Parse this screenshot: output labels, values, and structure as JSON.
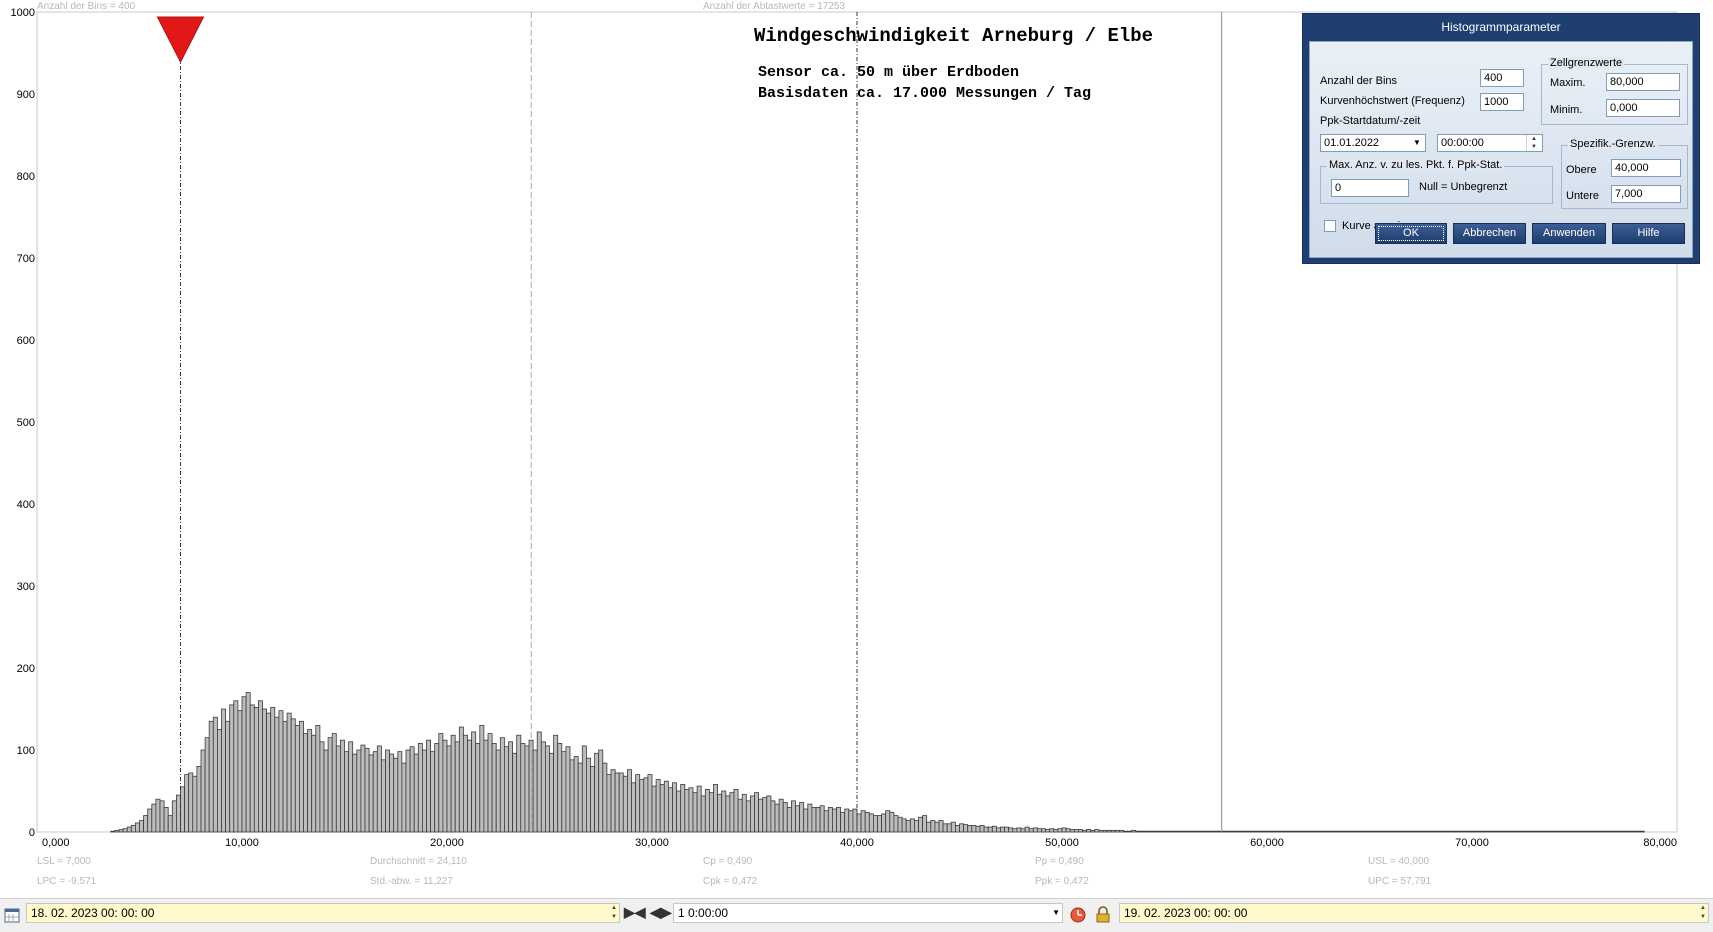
{
  "header_info": {
    "bins_label": "Anzahl der Bins =  400",
    "samples_label": "Anzahl der Abtastwerte = 17253"
  },
  "chart_title": {
    "title": "Windgeschwindigkeit  Arneburg / Elbe",
    "line1": "Sensor ca. 50 m über Erdboden",
    "line2": "Basisdaten ca. 17.000 Messungen / Tag"
  },
  "stats": {
    "lsl": "LSL = 7,000",
    "lpc": "LPC = -9,571",
    "mean": "Durchschnitt  = 24,110",
    "stddev": "Std.-abw. = 11,227",
    "cp": "Cp  = 0,490",
    "cpk": "Cpk = 0,472",
    "pp": "Pp  = 0,490",
    "ppk": "Ppk = 0,472",
    "usl": "USL = 40,000",
    "upc": "UPC = 57,791"
  },
  "chart_data": {
    "type": "bar",
    "title": "Windgeschwindigkeit  Arneburg / Elbe",
    "xlim": [
      0,
      80
    ],
    "ylim": [
      0,
      1000
    ],
    "x_tick_labels": [
      "0,000",
      "10,000",
      "20,000",
      "30,000",
      "40,000",
      "50,000",
      "60,000",
      "70,000",
      "80,000"
    ],
    "y_tick_labels": [
      "1000",
      "900",
      "800",
      "700",
      "600",
      "500",
      "400",
      "300",
      "200",
      "100",
      "0"
    ],
    "grid": false,
    "markers": {
      "lsl": 7.0,
      "mean": 24.11,
      "usl": 40.0,
      "upc": 57.791
    },
    "bin_width": 0.2,
    "series": [
      {
        "x_start": 3.6,
        "values": [
          1,
          2,
          3,
          4,
          6,
          8,
          11,
          14,
          20,
          28,
          34,
          40,
          38,
          30,
          20,
          38,
          45,
          55,
          70,
          72,
          68,
          80,
          100,
          115,
          135,
          140,
          125,
          150,
          135,
          155,
          160,
          148,
          165,
          170,
          155,
          152,
          160,
          150,
          145,
          152,
          140,
          148,
          135,
          145,
          138,
          130,
          135,
          120,
          125,
          118,
          130,
          110,
          100,
          115,
          120,
          105,
          112,
          98,
          110,
          95,
          100,
          106,
          102,
          94,
          98,
          105,
          88,
          100,
          95,
          90,
          98,
          84,
          100,
          104,
          95,
          108,
          100,
          112,
          98,
          108,
          120,
          112,
          105,
          118,
          110,
          128,
          118,
          112,
          122,
          108,
          130,
          112,
          120,
          108,
          100,
          115,
          104,
          110,
          96,
          118,
          108,
          105,
          112,
          100,
          122,
          110,
          105,
          96,
          118,
          108,
          98,
          104,
          88,
          92,
          84,
          105,
          90,
          80,
          96,
          100,
          84,
          70,
          76,
          72,
          72,
          68,
          76,
          60,
          70,
          64,
          66,
          70,
          56,
          64,
          58,
          62,
          54,
          60,
          50,
          58,
          52,
          54,
          48,
          56,
          44,
          52,
          48,
          58,
          46,
          50,
          44,
          48,
          52,
          40,
          46,
          38,
          44,
          48,
          40,
          42,
          44,
          38,
          34,
          40,
          36,
          30,
          38,
          32,
          36,
          28,
          34,
          30,
          30,
          32,
          26,
          30,
          28,
          30,
          24,
          28,
          26,
          28,
          22,
          26,
          24,
          22,
          20,
          20,
          22,
          26,
          24,
          20,
          18,
          16,
          14,
          16,
          14,
          18,
          20,
          12,
          14,
          12,
          14,
          10,
          10,
          12,
          8,
          10,
          9,
          8,
          8,
          7,
          8,
          6,
          6,
          7,
          5,
          6,
          6,
          5,
          4,
          5,
          4,
          6,
          4,
          5,
          4,
          4,
          3,
          4,
          3,
          4,
          5,
          4,
          3,
          3,
          3,
          2,
          3,
          2,
          3,
          2,
          2,
          2,
          2,
          2,
          2,
          1,
          1,
          2,
          1,
          1,
          1,
          1,
          1,
          1,
          1,
          1,
          1,
          1,
          1,
          1,
          1,
          1,
          1,
          1,
          1,
          1,
          1,
          1,
          1,
          1,
          1,
          1,
          1,
          1,
          1,
          1,
          1,
          1,
          1,
          1,
          1,
          1,
          1,
          1,
          1,
          1,
          1,
          1,
          1,
          1,
          1,
          1,
          1,
          1,
          1,
          1,
          1,
          1,
          1,
          1,
          1,
          1,
          1,
          1,
          1,
          1,
          1,
          1,
          1,
          1,
          1,
          1,
          1,
          1,
          1,
          1,
          1,
          1,
          1,
          1,
          1,
          1,
          1,
          1,
          1,
          1,
          1,
          1,
          1,
          1,
          1,
          1,
          1,
          1,
          1,
          1,
          1,
          1,
          1,
          1,
          1,
          1,
          1,
          1,
          1,
          1,
          1,
          1,
          1,
          1,
          1,
          1,
          1,
          1,
          1,
          1,
          1,
          1,
          1,
          1,
          1,
          1,
          1,
          1,
          1,
          1,
          1,
          1,
          1,
          1,
          1,
          1
        ]
      }
    ]
  },
  "dialog": {
    "title": "Histogrammparameter",
    "bins_label": "Anzahl der Bins",
    "bins_value": "400",
    "curve_max_label": "Kurvenhöchstwert (Frequenz)",
    "curve_max_value": "1000",
    "start_label": "Ppk-Startdatum/-zeit",
    "start_date": "01.01.2022",
    "start_time": "00:00:00",
    "cell_limits_title": "Zellgrenzwerte",
    "max_label": "Maxim.",
    "max_value": "80,000",
    "min_label": "Minim.",
    "min_value": "0,000",
    "max_points_title": "Max. Anz. v. zu les. Pkt. f. Ppk-Stat.",
    "max_points_value": "0",
    "null_hint": "Null = Unbegrenzt",
    "spec_title": "Spezifik.-Grenzw.",
    "upper_label": "Obere",
    "upper_value": "40,000",
    "lower_label": "Untere",
    "lower_value": "7,000",
    "show_curve_label": "Kurve anzeigen",
    "ok": "OK",
    "cancel": "Abbrechen",
    "apply": "Anwenden",
    "help": "Hilfe"
  },
  "bottom_bar": {
    "start": "18. 02. 2023   00: 00: 00",
    "interval": "1  0:00:00",
    "end": "19. 02. 2023   00: 00: 00"
  }
}
